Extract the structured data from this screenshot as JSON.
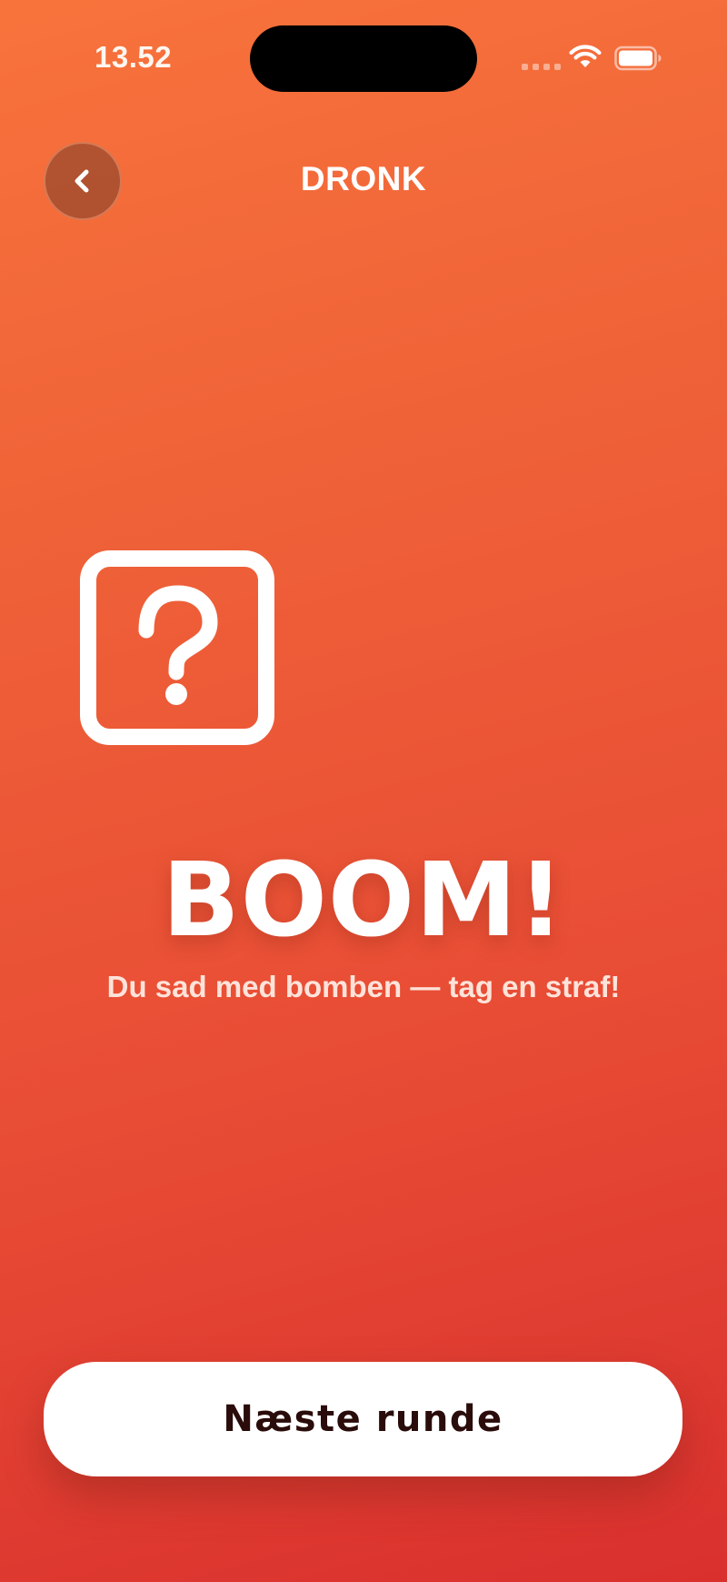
{
  "status_bar": {
    "time": "13.52"
  },
  "nav": {
    "back_icon": "chevron-left-icon",
    "title": "DRONK"
  },
  "result": {
    "icon": "question-mark-square-icon",
    "title": "BOOM!",
    "subtitle": "Du sad med bomben — tag en straf!"
  },
  "actions": {
    "next_round_label": "Næste runde"
  },
  "colors": {
    "gradient_top": "#f8733c",
    "gradient_bottom": "#d9302e",
    "button_background": "#ffffff",
    "button_text": "#2a0c0a"
  }
}
